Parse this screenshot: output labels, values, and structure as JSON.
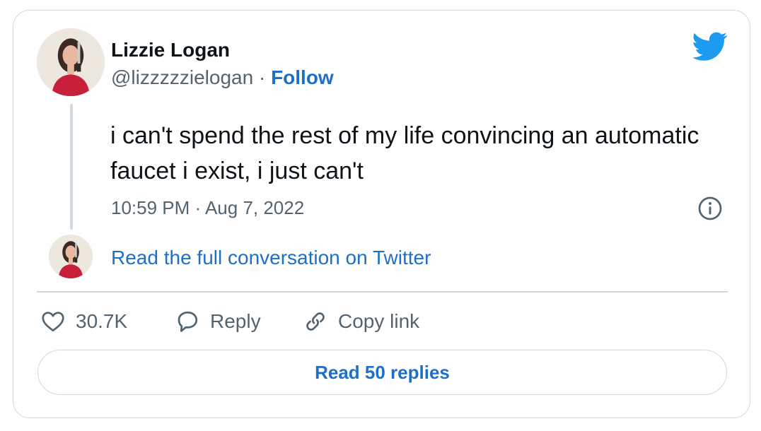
{
  "author": {
    "name": "Lizzie Logan",
    "handle": "@lizzzzzielogan",
    "separator": " · ",
    "follow_label": "Follow"
  },
  "tweet": {
    "text": "i can't spend the rest of my life convincing an automatic faucet i exist, i just can't",
    "timestamp": "10:59 PM · Aug 7, 2022"
  },
  "conversation_link": "Read the full conversation on Twitter",
  "actions": {
    "like_count": "30.7K",
    "reply_label": "Reply",
    "copy_label": "Copy link"
  },
  "read_replies_label": "Read 50 replies",
  "icons": {
    "brand": "twitter-bird-icon",
    "info": "info-icon",
    "like": "heart-icon",
    "reply": "speech-bubble-icon",
    "copy": "link-icon"
  },
  "colors": {
    "accent": "#1d6fc7",
    "brand": "#1d9bf0",
    "muted": "#536471",
    "border": "#cfd9de",
    "text": "#0f1419"
  }
}
